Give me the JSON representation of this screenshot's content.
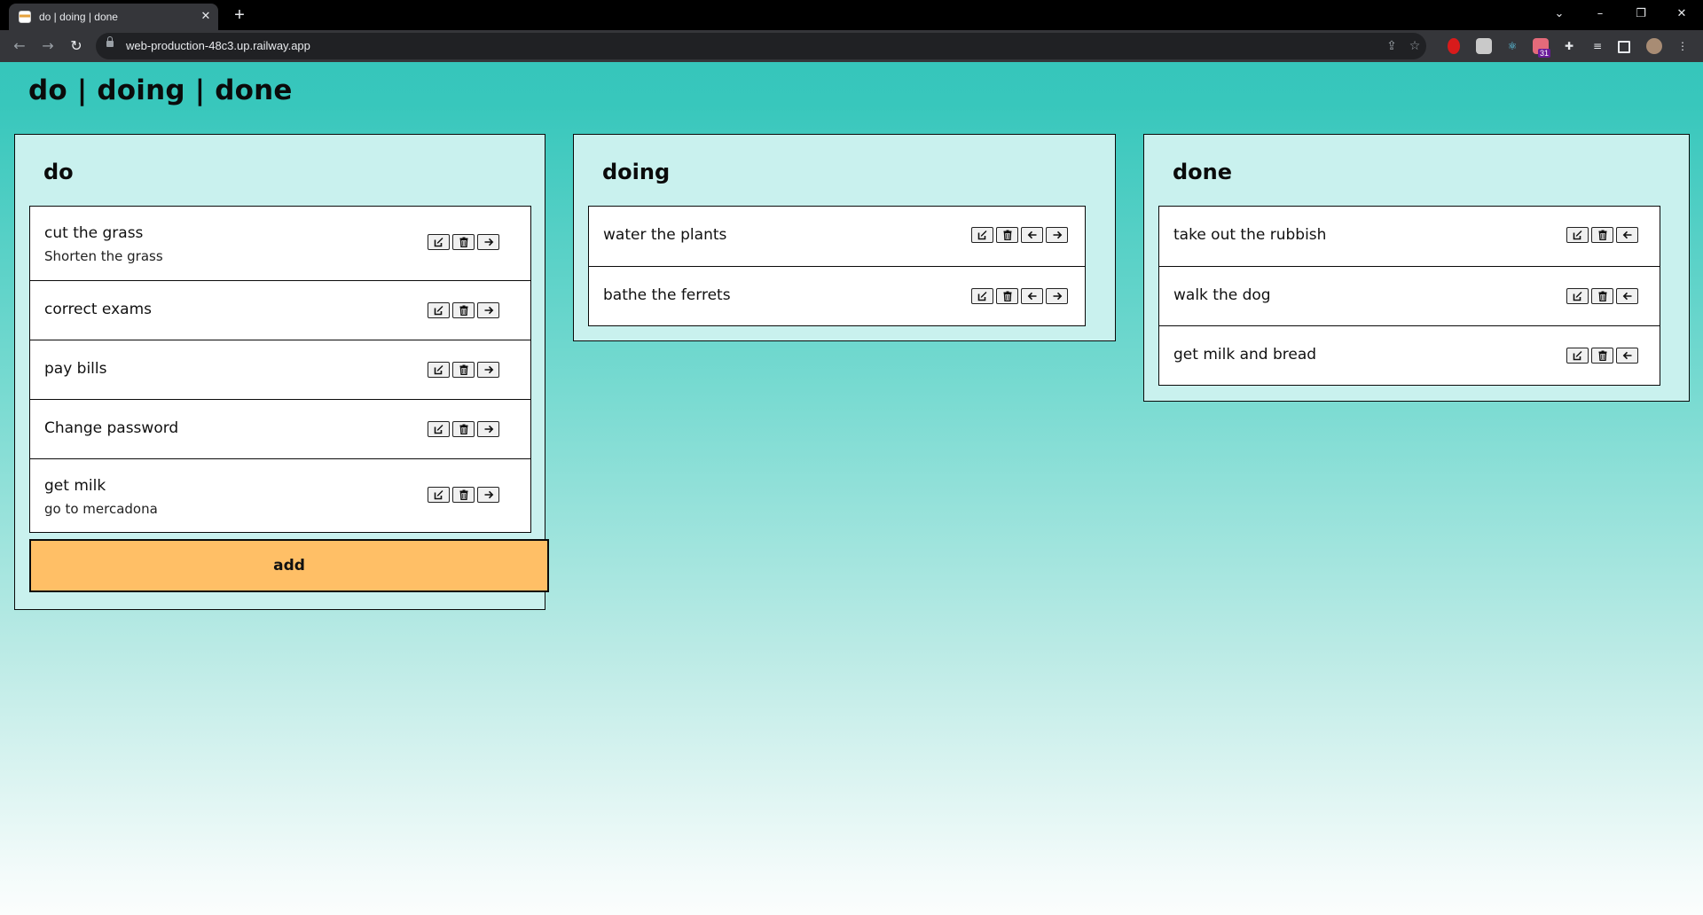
{
  "browser": {
    "tab_title": "do | doing | done",
    "url": "web-production-48c3.up.railway.app",
    "extension_badge": "31"
  },
  "page": {
    "title": "do | doing | done"
  },
  "columns": [
    {
      "title": "do",
      "tasks": [
        {
          "title": "cut the grass",
          "description": "Shorten the grass"
        },
        {
          "title": "correct exams",
          "description": ""
        },
        {
          "title": "pay bills",
          "description": ""
        },
        {
          "title": "Change password",
          "description": ""
        },
        {
          "title": "get milk",
          "description": "go to mercadona"
        }
      ],
      "add_label": "add"
    },
    {
      "title": "doing",
      "tasks": [
        {
          "title": "water the plants",
          "description": ""
        },
        {
          "title": "bathe the ferrets",
          "description": ""
        }
      ]
    },
    {
      "title": "done",
      "tasks": [
        {
          "title": "take out the rubbish",
          "description": ""
        },
        {
          "title": "walk the dog",
          "description": ""
        },
        {
          "title": "get milk and bread",
          "description": ""
        }
      ]
    }
  ],
  "icons": {
    "edit": "edit-icon",
    "delete": "trash-icon",
    "move_right": "arrow-right-icon",
    "move_left": "arrow-left-icon"
  }
}
